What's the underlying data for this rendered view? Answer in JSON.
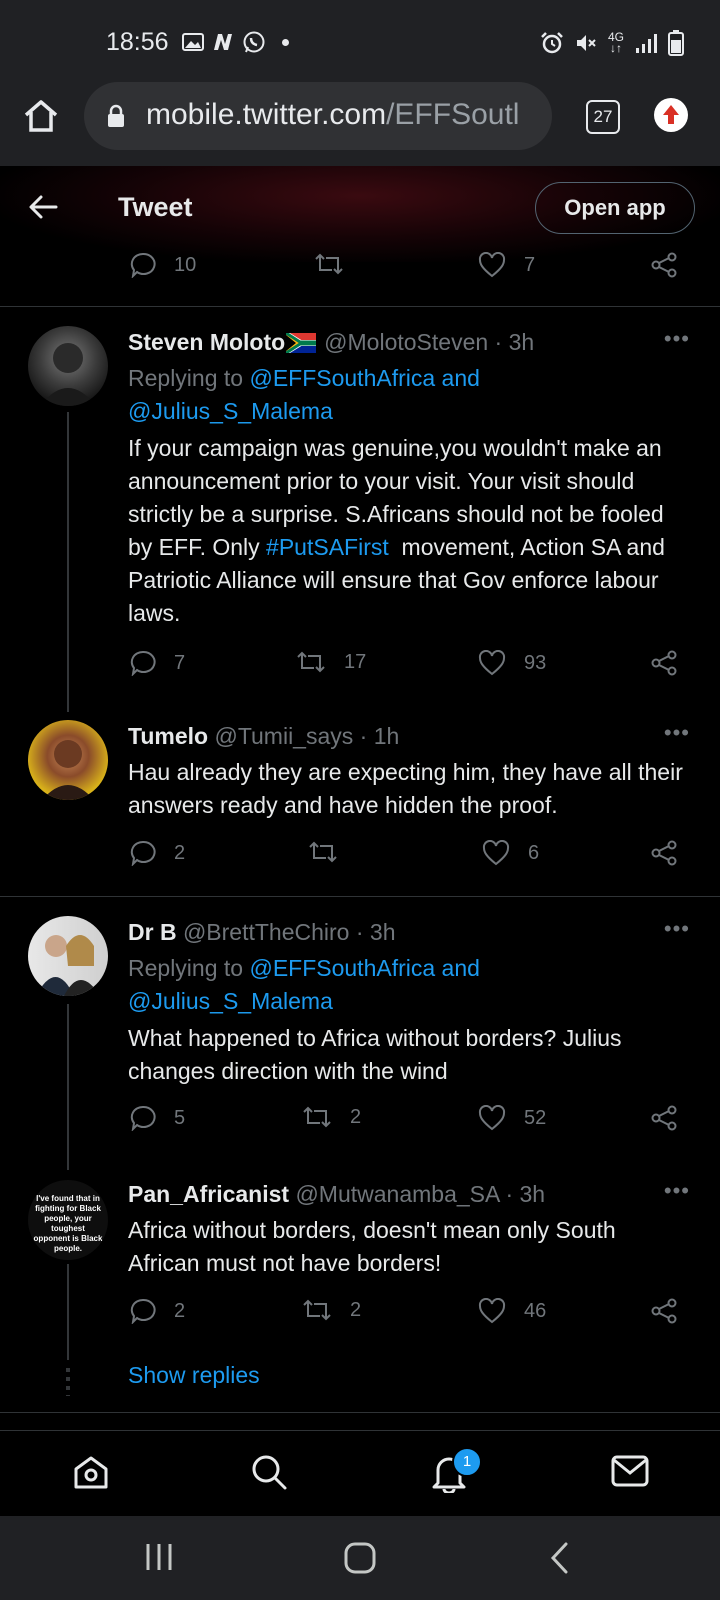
{
  "status_bar": {
    "time": "18:56",
    "left_icons": [
      "gallery-icon",
      "n-app-icon",
      "whatsapp-icon",
      "dot-icon"
    ],
    "right_icons": [
      "alarm-icon",
      "mute-icon",
      "4g-icon",
      "signal-icon",
      "battery-icon"
    ],
    "network": "4G"
  },
  "browser": {
    "url_host": "mobile.twitter.com",
    "url_path": "/EFFSoutl",
    "tab_count": "27"
  },
  "header": {
    "title": "Tweet",
    "open_app_label": "Open app"
  },
  "top_actions": {
    "replies": "10",
    "retweets": "",
    "likes": "7"
  },
  "tweets": [
    {
      "name": "Steven Moloto",
      "flag": "🇿🇦",
      "handle": "@MolotoSteven · 3h",
      "replying_prefix": "Replying to ",
      "replying_to": "@EFFSouthAfrica and",
      "replying_to2": "@Julius_S_Malema",
      "text_before": "If your campaign was genuine,you wouldn't make an announcement prior to your visit. Your visit should strictly be a surprise. S.Africans should not be fooled by EFF. Only ",
      "hashtag": "#PutSAFirst",
      "text_after": "  movement, Action SA and Patriotic Alliance will ensure that Gov enforce labour laws.",
      "replies": "7",
      "retweets": "17",
      "likes": "93"
    },
    {
      "name": "Tumelo",
      "handle": "@Tumii_says · 1h",
      "text": "Hau already they are expecting him, they have all their answers ready and have hidden the proof.",
      "replies": "2",
      "retweets": "",
      "likes": "6"
    },
    {
      "name": "Dr B",
      "handle": "@BrettTheChiro · 3h",
      "replying_prefix": "Replying to ",
      "replying_to": "@EFFSouthAfrica and",
      "replying_to2": "@Julius_S_Malema",
      "text": "What happened to Africa without borders? Julius changes direction with the wind",
      "replies": "5",
      "retweets": "2",
      "likes": "52"
    },
    {
      "name": "Pan_Africanist",
      "handle": "@Mutwanamba_SA · 3h",
      "avatar_text": "I've found that in fighting for Black people, your toughest opponent is Black people.",
      "text": "Africa without borders, doesn't mean only South African must not have borders!",
      "replies": "2",
      "retweets": "2",
      "likes": "46"
    }
  ],
  "show_replies": "Show replies",
  "bottom_nav": {
    "items": [
      "home-icon",
      "search-icon",
      "notifications-icon",
      "messages-icon"
    ],
    "notification_count": "1"
  },
  "colors": {
    "link": "#1d9bf0",
    "muted": "#71767b",
    "background": "#000000"
  }
}
